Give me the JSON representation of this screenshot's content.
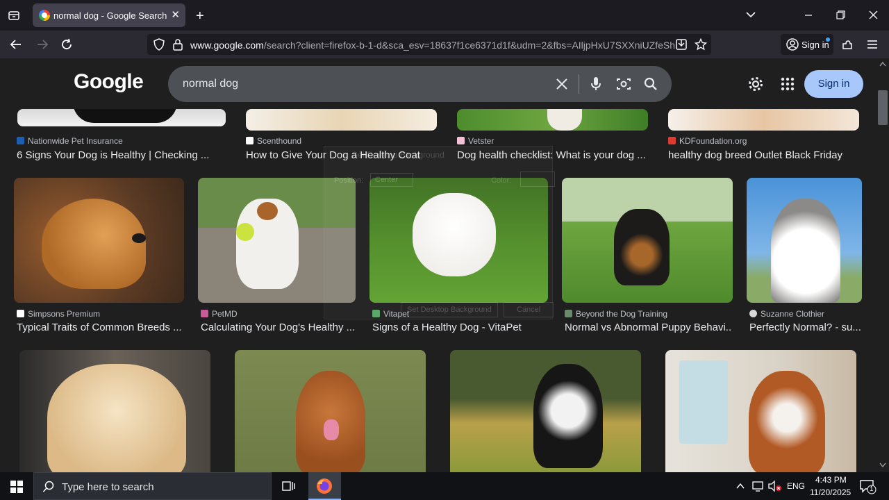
{
  "browser": {
    "tab_title": "normal dog - Google Search",
    "new_tab_symbol": "+",
    "url_host": "www.google.com",
    "url_rest": "/search?client=firefox-b-1-d&sca_esv=18637f1ce6371d1f&udm=2&fbs=AIljpHxU7SXXniUZfeSh",
    "signin_label": "Sign in"
  },
  "google": {
    "logo": "Google",
    "query": "normal dog",
    "signin_label": "Sign in"
  },
  "row1": [
    {
      "source": "Nationwide Pet Insurance",
      "caption": "6 Signs Your Dog is Healthy | Checking ..."
    },
    {
      "source": "Scenthound",
      "caption": "How to Give Your Dog a Healthy Coat"
    },
    {
      "source": "Vetster",
      "caption": "Dog health checklist: What is your dog ..."
    },
    {
      "source": "KDFoundation.org",
      "caption": "healthy dog breed Outlet Black Friday"
    }
  ],
  "row2": [
    {
      "source": "Simpsons Premium",
      "caption": "Typical Traits of Common Breeds ..."
    },
    {
      "source": "PetMD",
      "caption": "Calculating Your Dog's Healthy ..."
    },
    {
      "source": "Vitapet",
      "caption": "Signs of a Healthy Dog - VitaPet"
    },
    {
      "source": "Beyond the Dog Training",
      "caption": "Normal vs Abnormal Puppy Behavi..."
    },
    {
      "source": "Suzanne Clothier",
      "caption": "Perfectly Normal? - su..."
    }
  ],
  "ghost_dialog": {
    "position_label": "Position:",
    "position_value": "Center",
    "color_label": "Color:",
    "set_button": "Set Desktop Background",
    "cancel_button": "Cancel",
    "title": "Set Desktop Background"
  },
  "taskbar": {
    "search_placeholder": "Type here to search",
    "lang": "ENG",
    "time": "4:43 PM",
    "date": "11/20/2025",
    "notif_count": "1"
  },
  "colors": {
    "page_bg": "#1f1f1f",
    "google_signin_bg": "#a8c7fa"
  }
}
